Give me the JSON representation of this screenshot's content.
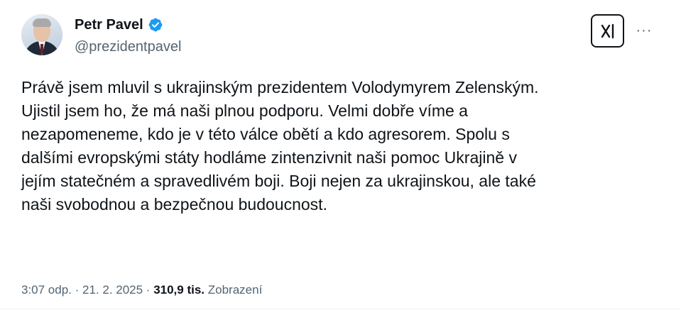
{
  "author": {
    "name": "Petr Pavel",
    "handle": "@prezidentpavel"
  },
  "actions": {
    "more_label": "···"
  },
  "tweet": {
    "lines": [
      "Právě jsem mluvil s ukrajinským prezidentem Volodymyrem Zelenským.",
      "Ujistil jsem ho, že má naši plnou podporu. Velmi dobře víme a",
      "nezapomeneme, kdo je v této válce obětí a kdo agresorem. Spolu s",
      "dalšími evropskými státy hodláme zintenzivnit naši pomoc Ukrajině v",
      "jejím statečném a spravedlivém boji. Boji nejen za ukrajinskou, ale také",
      "naši svobodnou a bezpečnou budoucnost."
    ]
  },
  "meta": {
    "time_date": "3:07 odp. · 21. 2. 2025 · ",
    "views_count": "310,9 tis.",
    "views_label": "Zobrazení"
  },
  "icons": {
    "verified": "verified-badge-icon",
    "grok": "grok-icon",
    "more": "more-options-icon"
  },
  "colors": {
    "text_primary": "#0f1419",
    "text_secondary": "#536471",
    "verified_blue": "#1d9bf0",
    "background": "#ffffff"
  }
}
